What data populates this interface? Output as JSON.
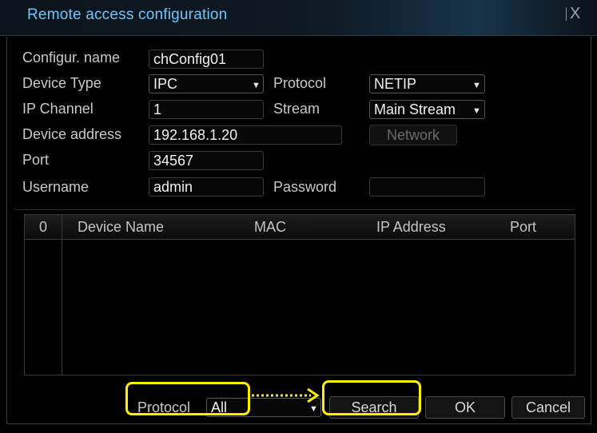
{
  "window": {
    "title": "Remote access configuration",
    "close_glyph": "X"
  },
  "form": {
    "config_name": {
      "label": "Configur. name",
      "value": "chConfig01"
    },
    "device_type": {
      "label": "Device Type",
      "value": "IPC"
    },
    "protocol": {
      "label": "Protocol",
      "value": "NETIP"
    },
    "ip_channel": {
      "label": "IP Channel",
      "value": "1"
    },
    "stream": {
      "label": "Stream",
      "value": "Main Stream"
    },
    "device_address": {
      "label": "Device address",
      "value": "192.168.1.20"
    },
    "network_button": "Network",
    "port": {
      "label": "Port",
      "value": "34567"
    },
    "username": {
      "label": "Username",
      "value": "admin"
    },
    "password": {
      "label": "Password",
      "value": ""
    }
  },
  "table": {
    "columns": [
      "0",
      "Device Name",
      "MAC",
      "IP Address",
      "Port"
    ],
    "rows": []
  },
  "footer": {
    "protocol_label": "Protocol",
    "protocol_value": "All",
    "search_button": "Search",
    "ok_button": "OK",
    "cancel_button": "Cancel"
  },
  "colors": {
    "title": "#6fc7ff",
    "highlight": "#ffee00"
  }
}
